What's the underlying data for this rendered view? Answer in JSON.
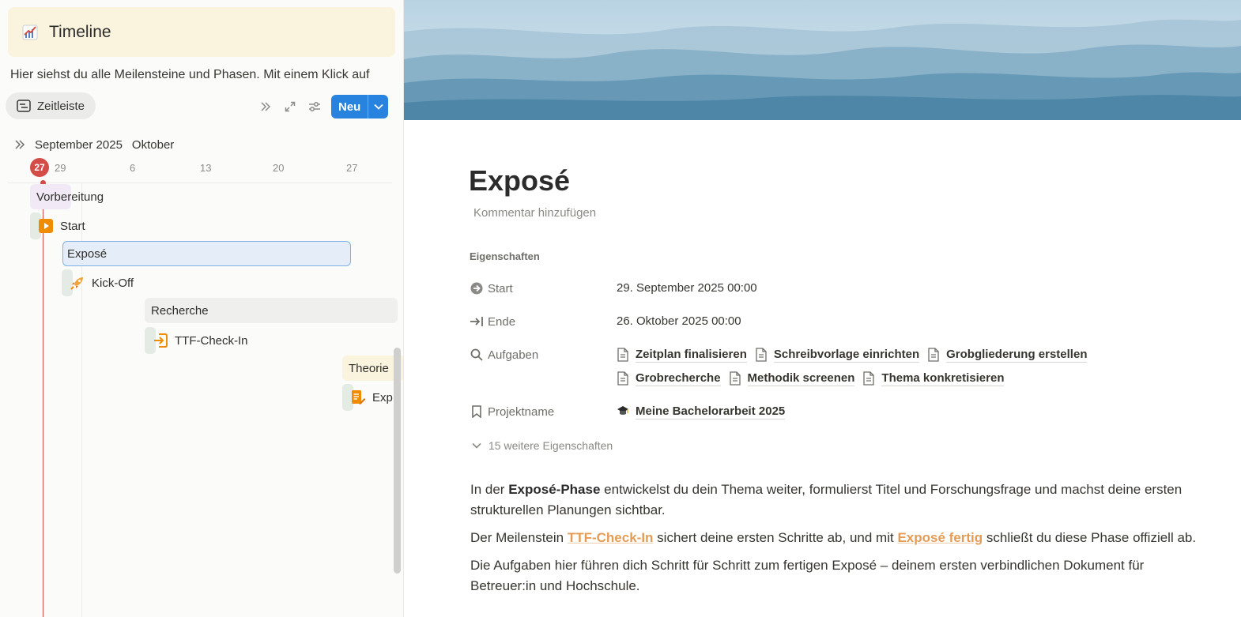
{
  "left": {
    "callout": {
      "title": "Timeline"
    },
    "intro": "Hier siehst du alle Meilensteine und Phasen. Mit einem Klick auf",
    "view_tab": "Zeitleiste",
    "new_button": "Neu",
    "months": {
      "current": "September 2025",
      "next": "Oktober"
    },
    "today": "27",
    "days": [
      "29",
      "6",
      "13",
      "20",
      "27"
    ],
    "items": {
      "vorbereitung": "Vorbereitung",
      "start": "Start",
      "expose": "Exposé",
      "kickoff": "Kick-Off",
      "recherche": "Recherche",
      "ttf": "TTF-Check-In",
      "theorie": "Theorie",
      "exp": "Exp"
    },
    "colors": {
      "accent": "#2783de",
      "today": "#d44c47",
      "milestone": "#f08c00"
    }
  },
  "right": {
    "title": "Exposé",
    "add_comment": "Kommentar hinzufügen",
    "properties_heading": "Eigenschaften",
    "props": {
      "start": {
        "key": "Start",
        "value": "29. September 2025 00:00"
      },
      "ende": {
        "key": "Ende",
        "value": "26. Oktober 2025 00:00"
      },
      "aufgaben": {
        "key": "Aufgaben",
        "items": [
          "Zeitplan finalisieren",
          "Schreibvorlage einrichten",
          "Grobgliederung erstellen",
          "Grobrecherche",
          "Methodik screenen",
          "Thema konkretisieren"
        ]
      },
      "projekt": {
        "key": "Projektname",
        "value": "Meine Bachelorarbeit 2025"
      }
    },
    "more_properties": "15 weitere Eigenschaften",
    "body": {
      "p1_a": "In der ",
      "p1_b": "Exposé-Phase",
      "p1_c": " entwickelst du dein Thema weiter, formulierst Titel und Forschungsfrage und machst deine ersten strukturellen Planungen sichtbar.",
      "p2_a": "Der Meilenstein ",
      "p2_link1": "TTF-Check-In",
      "p2_b": " sichert deine ersten Schritte ab, und mit ",
      "p2_link2": "Exposé fertig",
      "p2_c": " schließt du diese Phase offiziell ab.",
      "p3": "Die Aufgaben hier führen dich Schritt für Schritt zum fertigen Exposé – deinem ersten verbindlichen Dokument für Betreuer:in und Hochschule."
    }
  }
}
